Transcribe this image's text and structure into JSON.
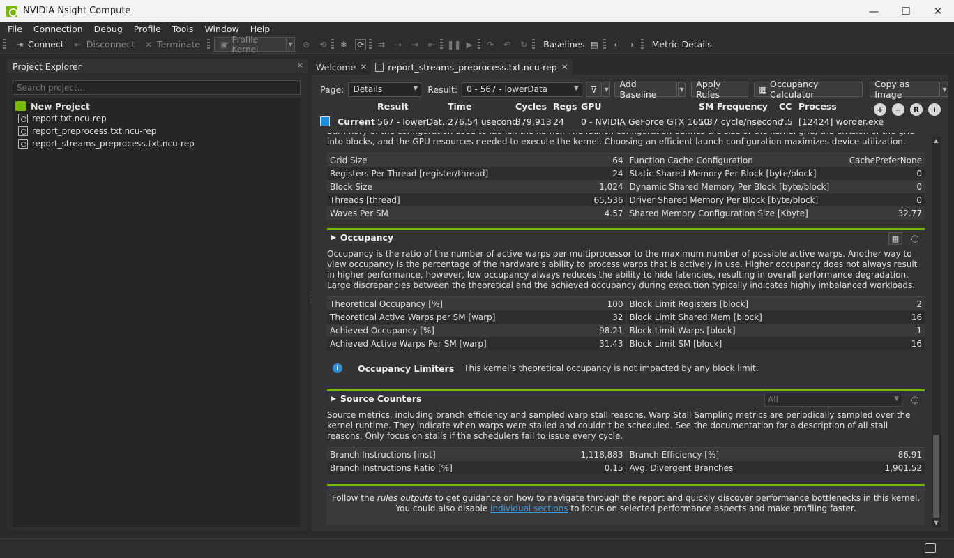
{
  "window": {
    "title": "NVIDIA Nsight Compute",
    "minimize": "—",
    "maximize": "☐",
    "close": "✕"
  },
  "menu": [
    "File",
    "Connection",
    "Debug",
    "Profile",
    "Tools",
    "Window",
    "Help"
  ],
  "toolbar": {
    "connect": "Connect",
    "disconnect": "Disconnect",
    "terminate": "Terminate",
    "profile_kernel": "Profile Kernel",
    "baselines": "Baselines",
    "metric_details": "Metric Details"
  },
  "project_explorer": {
    "title": "Project Explorer",
    "close": "×",
    "search_placeholder": "Search project...",
    "items": [
      {
        "label": "New Project",
        "type": "project"
      },
      {
        "label": "report.txt.ncu-rep",
        "type": "file"
      },
      {
        "label": "report_preprocess.txt.ncu-rep",
        "type": "file"
      },
      {
        "label": "report_streams_preprocess.txt.ncu-rep",
        "type": "file"
      }
    ]
  },
  "tabs": [
    {
      "label": "Welcome",
      "active": false
    },
    {
      "label": "report_streams_preprocess.txt.ncu-rep",
      "active": true
    }
  ],
  "controls": {
    "page_label": "Page:",
    "page_value": "Details",
    "result_label": "Result:",
    "result_value": "0 -   567 - lowerData",
    "add_baseline": "Add Baseline",
    "apply_rules": "Apply Rules",
    "occupancy_calculator": "Occupancy Calculator",
    "copy_as_image": "Copy as Image"
  },
  "result_header": {
    "columns": [
      "Result",
      "Time",
      "Cycles",
      "Regs",
      "GPU",
      "SM Frequency",
      "CC",
      "Process"
    ],
    "row_label": "Current",
    "values": [
      "567 - lowerDat...",
      "276.54 usecond",
      "379,913",
      "24",
      "0 - NVIDIA GeForce GTX 1650",
      "1.37 cycle/nsecond",
      "7.5",
      "[12424] worder.exe"
    ],
    "swatch_color": "#1f8fdb"
  },
  "launch_stats": {
    "description": "Summary of the configuration used to launch the kernel. The launch configuration defines the size of the kernel grid, the division of the grid into blocks, and the GPU resources needed to execute the kernel. Choosing an efficient launch configuration maximizes device utilization.",
    "left": [
      {
        "name": "Grid Size",
        "value": "64"
      },
      {
        "name": "Registers Per Thread [register/thread]",
        "value": "24"
      },
      {
        "name": "Block Size",
        "value": "1,024"
      },
      {
        "name": "Threads [thread]",
        "value": "65,536"
      },
      {
        "name": "Waves Per SM",
        "value": "4.57"
      }
    ],
    "right": [
      {
        "name": "Function Cache Configuration",
        "value": "CachePreferNone"
      },
      {
        "name": "Static Shared Memory Per Block [byte/block]",
        "value": "0"
      },
      {
        "name": "Dynamic Shared Memory Per Block [byte/block]",
        "value": "0"
      },
      {
        "name": "Driver Shared Memory Per Block [byte/block]",
        "value": "0"
      },
      {
        "name": "Shared Memory Configuration Size [Kbyte]",
        "value": "32.77"
      }
    ]
  },
  "occupancy": {
    "title": "Occupancy",
    "description": "Occupancy is the ratio of the number of active warps per multiprocessor to the maximum number of possible active warps. Another way to view occupancy is the percentage of the hardware's ability to process warps that is actively in use. Higher occupancy does not always result in higher performance, however, low occupancy always reduces the ability to hide latencies, resulting in overall performance degradation. Large discrepancies between the theoretical and the achieved occupancy during execution typically indicates highly imbalanced workloads.",
    "left": [
      {
        "name": "Theoretical Occupancy [%]",
        "value": "100"
      },
      {
        "name": "Theoretical Active Warps per SM [warp]",
        "value": "32"
      },
      {
        "name": "Achieved Occupancy [%]",
        "value": "98.21"
      },
      {
        "name": "Achieved Active Warps Per SM [warp]",
        "value": "31.43"
      }
    ],
    "right": [
      {
        "name": "Block Limit Registers [block]",
        "value": "2"
      },
      {
        "name": "Block Limit Shared Mem [block]",
        "value": "16"
      },
      {
        "name": "Block Limit Warps [block]",
        "value": "1"
      },
      {
        "name": "Block Limit SM [block]",
        "value": "16"
      }
    ],
    "limiters_title": "Occupancy Limiters",
    "limiters_text": "This kernel's theoretical occupancy is not impacted by any block limit."
  },
  "source_counters": {
    "title": "Source Counters",
    "filter_value": "All",
    "description": "Source metrics, including branch efficiency and sampled warp stall reasons. Warp Stall Sampling metrics are periodically sampled over the kernel runtime. They indicate when warps were stalled and couldn't be scheduled. See the documentation for a description of all stall reasons. Only focus on stalls if the schedulers fail to issue every cycle.",
    "left": [
      {
        "name": "Branch Instructions [inst]",
        "value": "1,118,883"
      },
      {
        "name": "Branch Instructions Ratio [%]",
        "value": "0.15"
      }
    ],
    "right": [
      {
        "name": "Branch Efficiency [%]",
        "value": "86.91"
      },
      {
        "name": "Avg. Divergent Branches",
        "value": "1,901.52"
      }
    ]
  },
  "footer": {
    "line1_a": "Follow the ",
    "line1_em": "rules outputs",
    "line1_b": " to get guidance on how to navigate through the report and quickly discover performance bottlenecks in this kernel.",
    "line2_a": "You could also disable ",
    "line2_link": "individual sections",
    "line2_b": " to focus on selected performance aspects and make profiling faster."
  },
  "colors": {
    "accent": "#76b900",
    "link": "#3a9be0"
  }
}
